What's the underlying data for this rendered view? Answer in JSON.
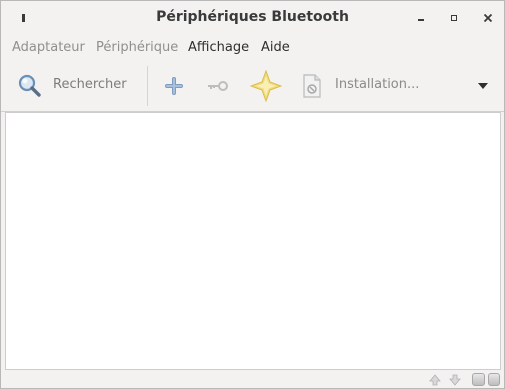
{
  "window": {
    "title": "Périphériques Bluetooth"
  },
  "menubar": {
    "items": [
      {
        "label": "Adaptateur",
        "enabled": false
      },
      {
        "label": "Périphérique",
        "enabled": false
      },
      {
        "label": "Affichage",
        "enabled": true
      },
      {
        "label": "Aide",
        "enabled": true
      }
    ]
  },
  "toolbar": {
    "search_label": "Rechercher",
    "setup_label": "Installation...",
    "icons": [
      "search-icon",
      "add-icon",
      "key-icon",
      "trust-star-icon",
      "setup-document-icon",
      "dropdown-arrow-icon"
    ]
  },
  "colors": {
    "window_bg": "#f3f2f1",
    "content_bg": "#ffffff",
    "text": "#2e2e2e",
    "disabled_text": "#8f8f8f",
    "accent_blue": "#6b90b8",
    "star_yellow": "#f2dc7a"
  }
}
